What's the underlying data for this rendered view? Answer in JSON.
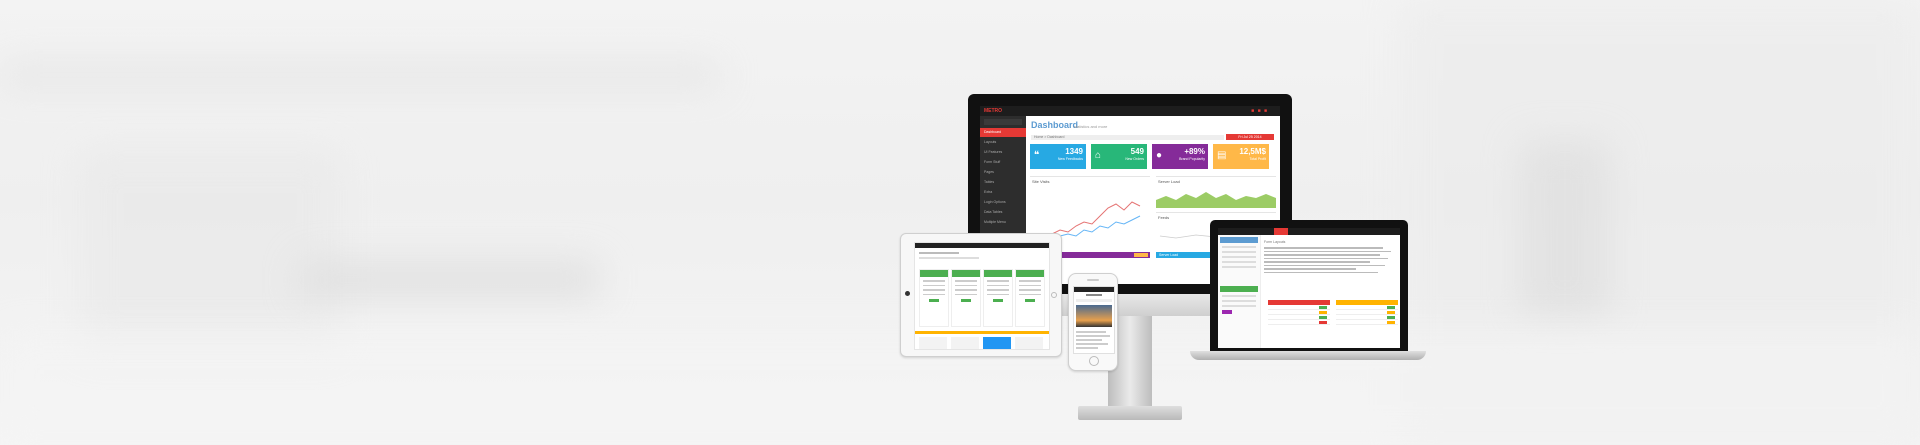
{
  "monitor": {
    "logo": "METRO",
    "top_icons": "■ ■ ■",
    "title": "Dashboard",
    "subtitle": "statistics and more",
    "action_button": "Fri Jul 25 2014",
    "breadcrumb": "Home > Dashboard",
    "sidebar_items": [
      "Dashboard",
      "Layouts",
      "UI Features",
      "Form Stuff",
      "Pages",
      "Tables",
      "Extra",
      "Login Options",
      "Data Tables",
      "Multiple Menu"
    ],
    "tiles": [
      {
        "value": "1349",
        "label": "New Feedbacks",
        "color": "#27a9e3",
        "icon": "❝"
      },
      {
        "value": "549",
        "label": "New Orders",
        "color": "#28b779",
        "icon": "⌂"
      },
      {
        "value": "+89%",
        "label": "Brand Popularity",
        "color": "#852b99",
        "icon": "●"
      },
      {
        "value": "12,5M$",
        "label": "Total Profit",
        "color": "#ffb848",
        "icon": "▤"
      }
    ],
    "panels": {
      "site_visits": "Site Visits",
      "server_load": "Server Load",
      "feeds": "Feeds",
      "server_load_2": "Server Load"
    }
  },
  "laptop": {
    "section": "Form Layouts"
  },
  "tablet": {
    "plans": [
      "Basic",
      "Pro",
      "Business",
      "Premium"
    ]
  },
  "phone": {
    "brand": "METRO"
  },
  "colors": {
    "accent": "#e53935",
    "blue": "#27a9e3",
    "green": "#28b779",
    "purple": "#852b99",
    "orange": "#ffb848"
  }
}
